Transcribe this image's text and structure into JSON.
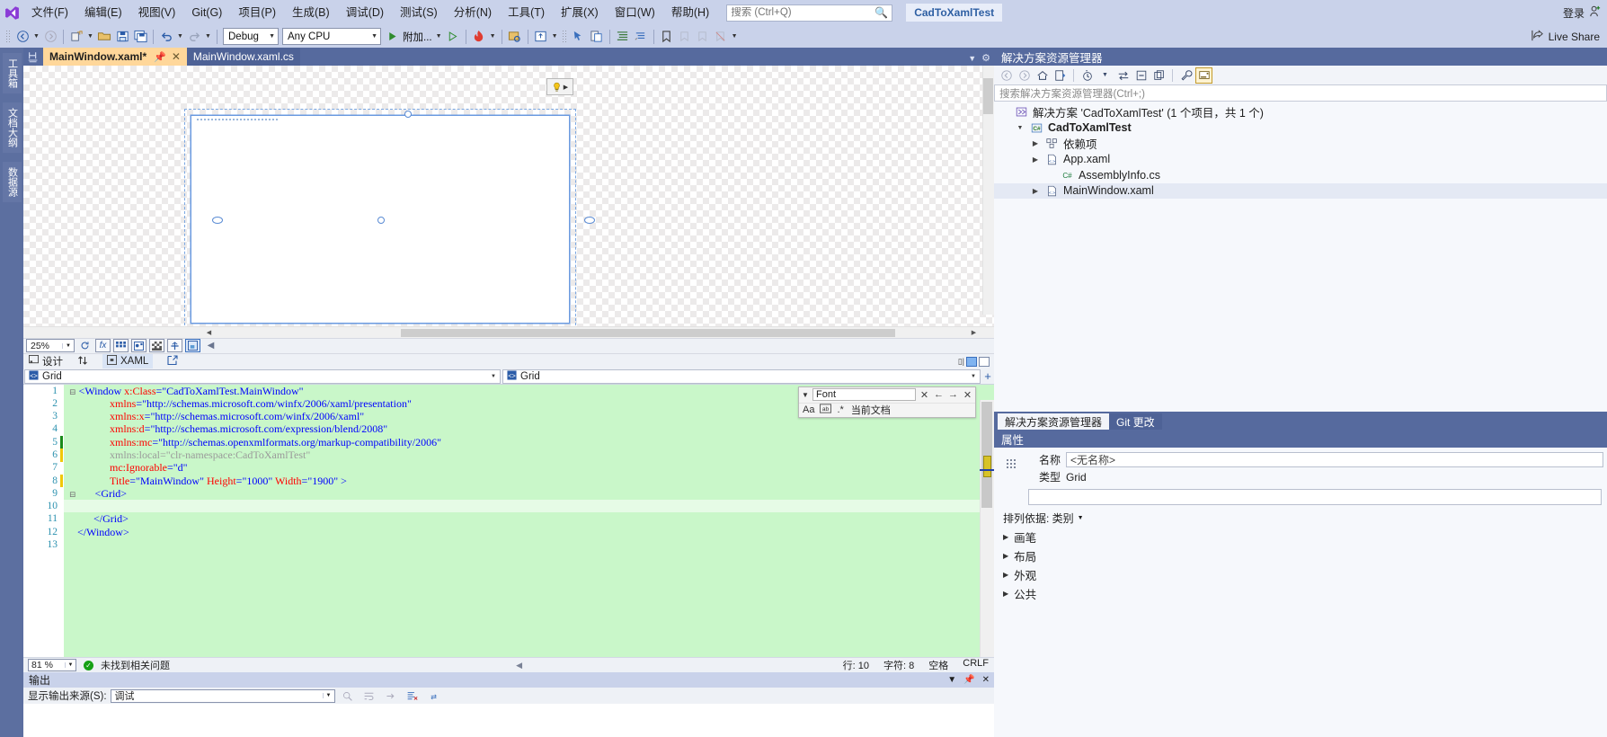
{
  "menu": {
    "logo": "visual-studio-logo",
    "items": [
      "文件(F)",
      "编辑(E)",
      "视图(V)",
      "Git(G)",
      "项目(P)",
      "生成(B)",
      "调试(D)",
      "测试(S)",
      "分析(N)",
      "工具(T)",
      "扩展(X)",
      "窗口(W)",
      "帮助(H)"
    ],
    "search_placeholder": "搜索 (Ctrl+Q)",
    "search_value": "",
    "project_chip": "CadToXamlTest",
    "login_label": "登录"
  },
  "toolbar": {
    "config": "Debug",
    "platform": "Any CPU",
    "attach_label": "附加...",
    "live_share": "Live Share"
  },
  "left_strip": {
    "tabs": [
      "工具箱",
      "文档大纲",
      "数据源"
    ]
  },
  "doc_tabs": {
    "active": "MainWindow.xaml*",
    "inactive": "MainWindow.xaml.cs",
    "pin_icon": "pin-icon",
    "close_icon": "close-icon"
  },
  "designer": {
    "zoom": "25%",
    "design_label": "设计",
    "xaml_label": "XAML",
    "swap_icon": "swap-panes-icon",
    "popout_icon": "pop-out-icon",
    "lightbulb": "lightbulb-icon"
  },
  "editor": {
    "nav_left": "Grid",
    "nav_right": "Grid",
    "zoom": "81 %",
    "status_message": "未找到相关问题",
    "line_label": "行: 10",
    "char_label": "字符: 8",
    "spaces_label": "空格",
    "eol_label": "CRLF",
    "lines": [
      {
        "n": 1,
        "tokens": [
          {
            "t": "<Window ",
            "c": "tag"
          },
          {
            "t": "x:Class",
            "c": "attr"
          },
          {
            "t": "=\"CadToXamlTest.MainWindow\"",
            "c": "val"
          }
        ],
        "indent": 0,
        "fold": true
      },
      {
        "n": 2,
        "tokens": [
          {
            "t": "xmlns",
            "c": "attr"
          },
          {
            "t": "=\"http://schemas.microsoft.com/winfx/2006/xaml/presentation\"",
            "c": "val"
          }
        ],
        "indent": 4
      },
      {
        "n": 3,
        "tokens": [
          {
            "t": "xmlns:x",
            "c": "attr"
          },
          {
            "t": "=\"http://schemas.microsoft.com/winfx/2006/xaml\"",
            "c": "val"
          }
        ],
        "indent": 4
      },
      {
        "n": 4,
        "tokens": [
          {
            "t": "xmlns:d",
            "c": "attr"
          },
          {
            "t": "=\"http://schemas.microsoft.com/expression/blend/2008\"",
            "c": "val"
          }
        ],
        "indent": 4
      },
      {
        "n": 5,
        "tokens": [
          {
            "t": "xmlns:mc",
            "c": "attr"
          },
          {
            "t": "=\"http://schemas.openxmlformats.org/markup-compatibility/2006\"",
            "c": "val"
          }
        ],
        "indent": 4
      },
      {
        "n": 6,
        "tokens": [
          {
            "t": "xmlns:local=\"clr-namespace:CadToXamlTest\"",
            "c": "dim"
          }
        ],
        "indent": 4
      },
      {
        "n": 7,
        "tokens": [
          {
            "t": "mc:Ignorable",
            "c": "attr"
          },
          {
            "t": "=\"d\"",
            "c": "val"
          }
        ],
        "indent": 4
      },
      {
        "n": 8,
        "tokens": [
          {
            "t": "Title",
            "c": "attr"
          },
          {
            "t": "=\"MainWindow\" ",
            "c": "val"
          },
          {
            "t": "Height",
            "c": "attr"
          },
          {
            "t": "=\"1000\" ",
            "c": "val"
          },
          {
            "t": "Width",
            "c": "attr"
          },
          {
            "t": "=\"1900\" >",
            "c": "val"
          }
        ],
        "indent": 4
      },
      {
        "n": 9,
        "tokens": [
          {
            "t": "<Grid>",
            "c": "tag"
          }
        ],
        "indent": 2,
        "fold": true
      },
      {
        "n": 10,
        "tokens": [
          {
            "t": "",
            "c": "tag"
          }
        ],
        "indent": 0,
        "blank": true
      },
      {
        "n": 11,
        "tokens": [
          {
            "t": "</Grid>",
            "c": "tag"
          }
        ],
        "indent": 2
      },
      {
        "n": 12,
        "tokens": [
          {
            "t": "</Window>",
            "c": "tag"
          }
        ],
        "indent": 0
      },
      {
        "n": 13,
        "tokens": [
          {
            "t": "",
            "c": "tag"
          }
        ],
        "indent": 0
      }
    ]
  },
  "find": {
    "query": "Font",
    "scope": "当前文档",
    "match_case_icon": "Aa",
    "match_word_icon": "match-whole-word-icon",
    "regex_icon": ".*",
    "prev_icon": "←",
    "next_icon": "→",
    "close_icon": "✕",
    "expand_icon": "chevron-down-icon"
  },
  "output": {
    "title": "输出",
    "source_label": "显示输出来源(S):",
    "source_value": "调试"
  },
  "solution_explorer": {
    "title": "解决方案资源管理器",
    "search_placeholder": "搜索解决方案资源管理器(Ctrl+;)",
    "tree": [
      {
        "label": "解决方案 'CadToXamlTest' (1 个项目，共 1 个)",
        "indent": 0,
        "icon": "solution-icon",
        "twisty": "",
        "bold": false
      },
      {
        "label": "CadToXamlTest",
        "indent": 1,
        "icon": "csharp-project-icon",
        "twisty": "▲",
        "bold": true
      },
      {
        "label": "依赖项",
        "indent": 2,
        "icon": "dependencies-icon",
        "twisty": "▶",
        "bold": false
      },
      {
        "label": "App.xaml",
        "indent": 2,
        "icon": "xaml-file-icon",
        "twisty": "▶",
        "bold": false
      },
      {
        "label": "AssemblyInfo.cs",
        "indent": 3,
        "icon": "csharp-file-icon",
        "twisty": "",
        "bold": false
      },
      {
        "label": "MainWindow.xaml",
        "indent": 2,
        "icon": "xaml-file-icon",
        "twisty": "▶",
        "bold": false,
        "selected": true
      }
    ],
    "tabs": [
      {
        "label": "解决方案资源管理器",
        "active": true
      },
      {
        "label": "Git 更改",
        "active": false
      }
    ]
  },
  "properties": {
    "title": "属性",
    "name_label": "名称",
    "name_value": "<无名称>",
    "type_label": "类型",
    "type_value": "Grid",
    "search_value": "",
    "sort_label": "排列依据: 类别",
    "categories": [
      "画笔",
      "布局",
      "外观",
      "公共"
    ]
  },
  "colors": {
    "chrome": "#c9d2ea",
    "dock": "#566a9e",
    "accent_tab": "#ffd79a",
    "code_highlight": "#c9f7c9",
    "attr_red": "#ff0000",
    "tag_blue": "#0000ff",
    "linenum": "#2b91af"
  }
}
